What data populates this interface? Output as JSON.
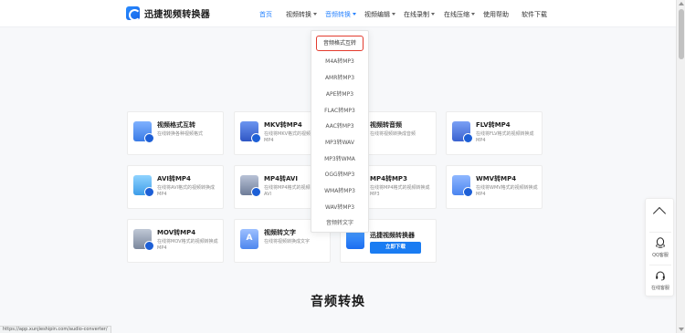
{
  "header": {
    "logo_text": "迅捷视频转换器",
    "nav": {
      "home": "首页",
      "video_convert": "视频转换",
      "audio_convert": "音频转换",
      "video_edit": "视频编辑",
      "online_record": "在线录制",
      "online_compress": "在线压缩",
      "help": "使用帮助",
      "download": "软件下载"
    },
    "active_nav": "音频转换",
    "accent_color": "#2a84ff"
  },
  "dropdown": {
    "items": [
      "音频格式互转",
      "M4A转MP3",
      "AMR转MP3",
      "APE转MP3",
      "FLAC转MP3",
      "AAC转MP3",
      "MP3转WAV",
      "MP3转WMA",
      "OGG转MP3",
      "WMA转MP3",
      "WAV转MP3",
      "音频转文字"
    ],
    "highlight_color": "#e33b2e"
  },
  "cards": {
    "video_format": {
      "title": "视频格式互转",
      "desc": "在线转换各种视频格式",
      "icon": "video-file-icon"
    },
    "mkv_mp4": {
      "title": "MKV转MP4",
      "desc": "在线将MKV格式的视频转换成MP4",
      "icon": "mkv-file-icon"
    },
    "video_audio": {
      "title": "视频转音频",
      "desc": "在线将视频转换成音频",
      "icon": "audio-file-icon"
    },
    "flv_mp4": {
      "title": "FLV转MP4",
      "desc": "在线将FLV格式的视频转换成MP4",
      "icon": "flv-file-icon"
    },
    "avi_mp4": {
      "title": "AVI转MP4",
      "desc": "在线将AVI格式的视频转换成MP4",
      "icon": "avi-file-icon"
    },
    "mp4_avi": {
      "title": "MP4转AVI",
      "desc": "在线将MP4格式的视频转换成AVI",
      "icon": "mp4-file-icon"
    },
    "mp4_mp3": {
      "title": "MP4转MP3",
      "desc": "在线将MP4格式的视频转换成MP3",
      "icon": "mp4-audio-file-icon"
    },
    "wmv_mp4": {
      "title": "WMV转MP4",
      "desc": "在线将WMV格式的视频转换成MP4",
      "icon": "wmv-file-icon"
    },
    "mov_mp4": {
      "title": "MOV转MP4",
      "desc": "在线将MOV格式的视频转换成MP4",
      "icon": "mov-file-icon"
    },
    "video_text": {
      "title": "视频转文字",
      "desc": "在线将视频转换成文字",
      "icon": "text-file-icon",
      "icon_letter": "A"
    },
    "app_promo": {
      "title": "迅捷视频转换器",
      "button": "立即下载",
      "icon": "app-icon"
    }
  },
  "section_title": "音频转换",
  "float_panel": {
    "up_icon": "arrow-up-icon",
    "qq_label": "QQ客服",
    "online_label": "在线客服"
  },
  "status_url": "https://app.xunjieshipin.com/audio-converter/"
}
